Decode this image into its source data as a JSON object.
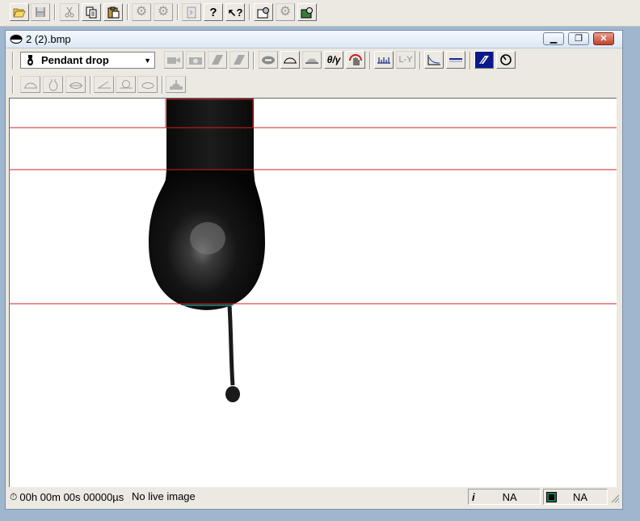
{
  "main_toolbar": {
    "buttons": [
      {
        "name": "open-file-button",
        "icon": "folder-open-icon"
      },
      {
        "name": "save-button",
        "icon": "floppy-disk-icon"
      },
      {
        "name": "cut-button",
        "icon": "scissors-icon"
      },
      {
        "name": "copy-button",
        "icon": "copy-icon"
      },
      {
        "name": "paste-button",
        "icon": "clipboard-icon"
      },
      {
        "name": "settings-button",
        "icon": "gear-icon"
      },
      {
        "name": "settings-tools-button",
        "icon": "gear-wrench-icon"
      },
      {
        "name": "exit-button",
        "icon": "exit-door-icon"
      },
      {
        "name": "help-button",
        "icon": "question-mark-icon"
      },
      {
        "name": "context-help-button",
        "icon": "pointer-question-icon"
      },
      {
        "name": "open-dialog-button",
        "icon": "folder-gear-icon"
      },
      {
        "name": "device-settings-button",
        "icon": "gear-icon"
      },
      {
        "name": "camera-settings-button",
        "icon": "camera-gear-icon"
      }
    ]
  },
  "window": {
    "title": "2 (2).bmp",
    "title_icon": "drop-eye-icon",
    "minimize_glyph": "▁",
    "restore_glyph": "❐",
    "close_glyph": "✕"
  },
  "method_toolbar": {
    "method_select": {
      "value": "Pendant drop",
      "icon": "pendant-drop-icon"
    }
  },
  "canvas": {
    "background": "#ffffff",
    "baseline_color": "#d42020",
    "needle_edge_color": "#1fc8c8"
  },
  "statusbar": {
    "time": "00h 00m 00s 00000µs",
    "live_status": "No live image",
    "info_value": "NA",
    "frame_value": "NA"
  },
  "colors": {
    "toolbar_bg": "#ece9e2",
    "mdi_bg": "#9fb6cf",
    "window_border": "#7a8ea8",
    "select_active_blue": "#0a1a8c"
  }
}
